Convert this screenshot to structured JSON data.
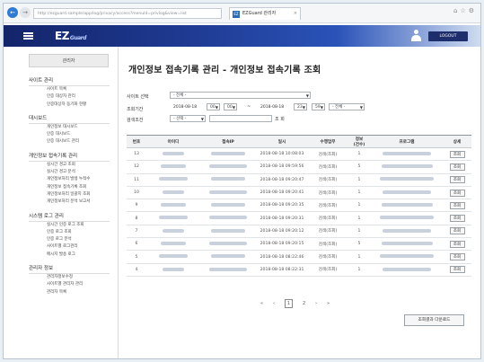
{
  "browser": {
    "url": "http://ezguard.sample/app/log/privacy/access?menuId=privlog&view=list",
    "tab_title": "EZGuard 관리자",
    "tab_favicon": "EZ"
  },
  "header": {
    "logo": "EZ",
    "logo_sub": "Guard",
    "logout_label": "LOGOUT"
  },
  "sidebar": {
    "admin_label": "관리자",
    "groups": [
      {
        "title": "사이트 관리",
        "items": [
          "사이트 목록",
          "인증 대상자 관리",
          "인증대상자 동기화 현황"
        ]
      },
      {
        "title": "대시보드",
        "items": [
          "개인정보 대시보드",
          "인증 대시보드",
          "인증 대시보드 관리"
        ]
      },
      {
        "title": "개인정보 접속기록 관리",
        "items": [
          "실시간 경고 조회",
          "실시간 경고 분석",
          "개인정보처리 발생 누적수",
          "개인정보 접속기록 조회",
          "개인정보처리 일괄지 조회",
          "개인정보처리 분석 보고서"
        ]
      },
      {
        "title": "시스템 로그 관리",
        "items": [
          "실시간 인증 로그 조회",
          "인증 로그 조회",
          "인증 로그 분석",
          "사이트별 로그관리",
          "메시지 발송 로그"
        ]
      },
      {
        "title": "관리자 정보",
        "items": [
          "관리자정보수정",
          "사이트별 관리자 관리",
          "관리자 목록"
        ]
      }
    ]
  },
  "main": {
    "title": "개인정보 접속기록 관리 - 개인정보 접속기록 조회",
    "filters": {
      "site_label": "사이트 선택",
      "site_value": "- 전체 -",
      "period_label": "조회기간",
      "start_date": "2018-08-18",
      "start_hour": "00",
      "start_min": "00",
      "tilde": "~",
      "end_date": "2018-08-18",
      "end_hour": "23",
      "end_min": "59",
      "period_select": "- 전체 -",
      "cond_label": "검색조건",
      "cond_value": "- 선택 -",
      "search_label": "조 회"
    },
    "columns": [
      "번호",
      "아이디",
      "접속IP",
      "일시",
      "수행업무",
      "정보\n(건수)",
      "프로그램",
      "상세"
    ],
    "rows": [
      {
        "no": "13",
        "time": "2018-08-18 10:08:03",
        "task": "검색(조회)",
        "count": "1"
      },
      {
        "no": "12",
        "time": "2018-08-18 09:59:56",
        "task": "검색(조회)",
        "count": "5"
      },
      {
        "no": "11",
        "time": "2018-08-18 09:20:47",
        "task": "검색(조회)",
        "count": "1"
      },
      {
        "no": "10",
        "time": "2018-08-18 09:20:41",
        "task": "검색(조회)",
        "count": "1"
      },
      {
        "no": "9",
        "time": "2018-08-18 09:20:35",
        "task": "검색(조회)",
        "count": "1"
      },
      {
        "no": "8",
        "time": "2018-08-18 09:20:31",
        "task": "검색(조회)",
        "count": "1"
      },
      {
        "no": "7",
        "time": "2018-08-18 09:20:12",
        "task": "검색(조회)",
        "count": "1"
      },
      {
        "no": "6",
        "time": "2018-08-18 09:20:15",
        "task": "검색(조회)",
        "count": "5"
      },
      {
        "no": "5",
        "time": "2018-08-18 08:22:46",
        "task": "검색(조회)",
        "count": "1"
      },
      {
        "no": "4",
        "time": "2018-08-18 08:22:31",
        "task": "검색(조회)",
        "count": "1"
      }
    ],
    "detail_label": "조회",
    "pager": {
      "first": "«",
      "prev": "‹",
      "page1": "1",
      "page2": "2",
      "next": "›",
      "last": "»"
    },
    "download_label": "조회결과 다운로드"
  }
}
